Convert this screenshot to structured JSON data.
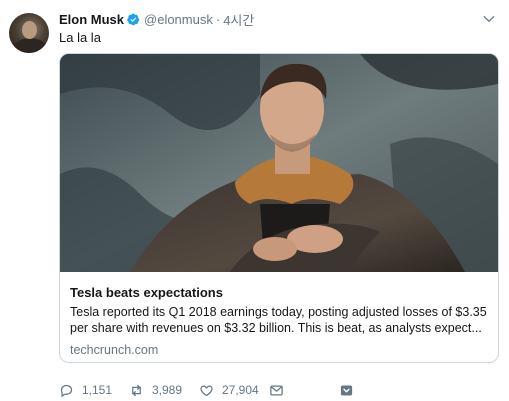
{
  "tweet": {
    "author_name": "Elon Musk",
    "handle": "@elonmusk",
    "separator": "·",
    "time": "4시간",
    "text": "La la la"
  },
  "card": {
    "title": "Tesla beats expectations",
    "description": "Tesla reported its Q1 2018 earnings today, posting adjusted losses of $3.35 per share with revenues on $3.32 billion. This is beat, as analysts expect...",
    "domain": "techcrunch.com"
  },
  "actions": {
    "replies": "1,151",
    "retweets": "3,989",
    "likes": "27,904"
  },
  "icons": {
    "verified": "verified-badge-icon",
    "caret": "chevron-down-icon",
    "reply": "reply-icon",
    "retweet": "retweet-icon",
    "like": "heart-icon",
    "dm": "envelope-icon",
    "bookmark": "bookmark-icon"
  },
  "colors": {
    "verified": "#1da1f2",
    "secondary_text": "#657786",
    "card_border": "#cdd6dd"
  }
}
